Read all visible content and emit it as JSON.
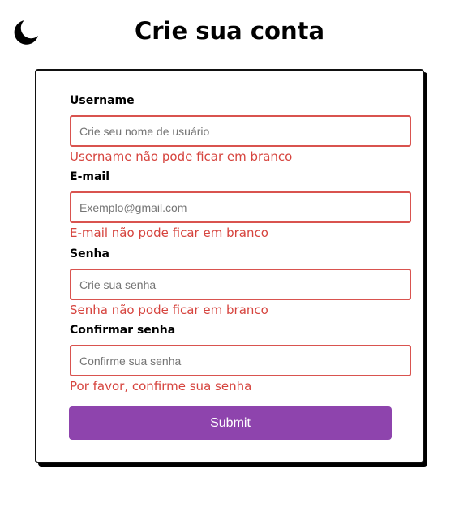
{
  "header": {
    "title": "Crie sua conta",
    "logo_icon": "crescent-moon-icon"
  },
  "form": {
    "fields": [
      {
        "label": "Username",
        "placeholder": "Crie seu nome de usuário",
        "value": "",
        "error": "Username não pode ficar em branco"
      },
      {
        "label": "E-mail",
        "placeholder": "Exemplo@gmail.com",
        "value": "",
        "error": "E-mail não pode ficar em branco"
      },
      {
        "label": "Senha",
        "placeholder": "Crie sua senha",
        "value": "",
        "error": "Senha não pode ficar em branco"
      },
      {
        "label": "Confirmar senha",
        "placeholder": "Confirme sua senha",
        "value": "",
        "error": "Por favor, confirme sua senha"
      }
    ],
    "submit_label": "Submit"
  },
  "colors": {
    "accent": "#8e44ad",
    "error": "#d6443e",
    "border": "#111111"
  }
}
